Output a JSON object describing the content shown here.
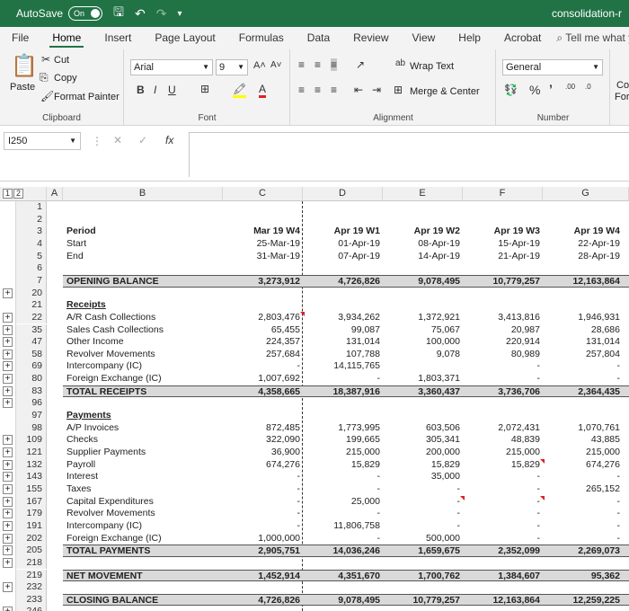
{
  "titlebar": {
    "autosave_label": "AutoSave",
    "autosave_state": "On",
    "doc_title": "consolidation-r"
  },
  "tabs": [
    "File",
    "Home",
    "Insert",
    "Page Layout",
    "Formulas",
    "Data",
    "Review",
    "View",
    "Help",
    "Acrobat"
  ],
  "active_tab": "Home",
  "tell_me": "Tell me what you w",
  "ribbon": {
    "clipboard": {
      "paste": "Paste",
      "cut": "Cut",
      "copy": "Copy",
      "format_painter": "Format Painter",
      "label": "Clipboard"
    },
    "font": {
      "name": "Arial",
      "size": "9",
      "label": "Font"
    },
    "alignment": {
      "wrap_text": "Wrap Text",
      "merge_center": "Merge & Center",
      "label": "Alignment"
    },
    "number": {
      "format": "General",
      "label": "Number"
    },
    "cond_partial": [
      "Co",
      "For"
    ]
  },
  "formula_bar": {
    "namebox": "I250",
    "fx": "fx"
  },
  "columns": [
    "A",
    "B",
    "C",
    "D",
    "E",
    "F",
    "G"
  ],
  "outline_levels": [
    "1",
    "2"
  ],
  "rows": [
    {
      "n": "1"
    },
    {
      "n": "2"
    },
    {
      "n": "3",
      "label": "Period",
      "bold": true,
      "vals": [
        "Mar 19 W4",
        "Apr 19 W1",
        "Apr 19 W2",
        "Apr 19 W3",
        "Apr 19 W4"
      ],
      "valbold": true
    },
    {
      "n": "4",
      "label": "Start",
      "vals": [
        "25-Mar-19",
        "01-Apr-19",
        "08-Apr-19",
        "15-Apr-19",
        "22-Apr-19"
      ]
    },
    {
      "n": "5",
      "label": "End",
      "vals": [
        "31-Mar-19",
        "07-Apr-19",
        "14-Apr-19",
        "21-Apr-19",
        "28-Apr-19"
      ]
    },
    {
      "n": "6"
    },
    {
      "n": "7",
      "label": "OPENING BALANCE",
      "bold": true,
      "shade": true,
      "vals": [
        "3,273,912",
        "4,726,826",
        "9,078,495",
        "10,779,257",
        "12,163,864"
      ],
      "valbold": true
    },
    {
      "n": "20",
      "plus": true
    },
    {
      "n": "21",
      "label": "Receipts",
      "bold": true,
      "underline": true
    },
    {
      "n": "22",
      "plus": true,
      "label": "A/R Cash Collections",
      "vals": [
        "2,803,476",
        "3,934,262",
        "1,372,921",
        "3,413,816",
        "1,946,931"
      ],
      "note": 1
    },
    {
      "n": "35",
      "plus": true,
      "label": "Sales Cash Collections",
      "vals": [
        "65,455",
        "99,087",
        "75,067",
        "20,987",
        "28,686"
      ]
    },
    {
      "n": "47",
      "plus": true,
      "label": "Other Income",
      "vals": [
        "224,357",
        "131,014",
        "100,000",
        "220,914",
        "131,014"
      ]
    },
    {
      "n": "58",
      "plus": true,
      "label": "Revolver Movements",
      "vals": [
        "257,684",
        "107,788",
        "9,078",
        "80,989",
        "257,804"
      ]
    },
    {
      "n": "69",
      "plus": true,
      "label": "Intercompany (IC)",
      "vals": [
        "-",
        "14,115,765",
        "",
        "-",
        "-"
      ]
    },
    {
      "n": "80",
      "plus": true,
      "label": "Foreign Exchange (IC)",
      "vals": [
        "1,007,692",
        "-",
        "1,803,371",
        "-",
        "-"
      ]
    },
    {
      "n": "83",
      "plus": true,
      "label": "TOTAL RECEIPTS",
      "bold": true,
      "shade": true,
      "vals": [
        "4,358,665",
        "18,387,916",
        "3,360,437",
        "3,736,706",
        "2,364,435"
      ],
      "valbold": true
    },
    {
      "n": "96",
      "plus": true
    },
    {
      "n": "97",
      "label": "Payments",
      "bold": true,
      "underline": true
    },
    {
      "n": "98",
      "label": "A/P Invoices",
      "vals": [
        "872,485",
        "1,773,995",
        "603,506",
        "2,072,431",
        "1,070,761"
      ]
    },
    {
      "n": "109",
      "plus": true,
      "label": "Checks",
      "vals": [
        "322,090",
        "199,665",
        "305,341",
        "48,839",
        "43,885"
      ]
    },
    {
      "n": "121",
      "plus": true,
      "label": "Supplier Payments",
      "vals": [
        "36,900",
        "215,000",
        "200,000",
        "215,000",
        "215,000"
      ]
    },
    {
      "n": "132",
      "plus": true,
      "label": "Payroll",
      "vals": [
        "674,276",
        "15,829",
        "15,829",
        "15,829",
        "674,276"
      ],
      "note": 4
    },
    {
      "n": "143",
      "plus": true,
      "label": "Interest",
      "vals": [
        "-",
        "-",
        "35,000",
        "-",
        "-"
      ]
    },
    {
      "n": "155",
      "plus": true,
      "label": "Taxes",
      "vals": [
        "-",
        "-",
        "-",
        "-",
        "265,152"
      ]
    },
    {
      "n": "167",
      "plus": true,
      "label": "Capital Expenditures",
      "vals": [
        "-",
        "25,000",
        "-",
        "-",
        "-"
      ],
      "note": 3,
      "note2": 4
    },
    {
      "n": "179",
      "plus": true,
      "label": "Revolver Movements",
      "vals": [
        "-",
        "-",
        "-",
        "-",
        "-"
      ]
    },
    {
      "n": "191",
      "plus": true,
      "label": "Intercompany (IC)",
      "vals": [
        "-",
        "11,806,758",
        "-",
        "-",
        "-"
      ]
    },
    {
      "n": "202",
      "plus": true,
      "label": "Foreign Exchange (IC)",
      "vals": [
        "1,000,000",
        "-",
        "500,000",
        "-",
        "-"
      ]
    },
    {
      "n": "205",
      "plus": true,
      "label": "TOTAL PAYMENTS",
      "bold": true,
      "shade": true,
      "vals": [
        "2,905,751",
        "14,036,246",
        "1,659,675",
        "2,352,099",
        "2,269,073"
      ],
      "valbold": true
    },
    {
      "n": "218",
      "plus": true
    },
    {
      "n": "219",
      "label": "NET MOVEMENT",
      "bold": true,
      "shade": true,
      "vals": [
        "1,452,914",
        "4,351,670",
        "1,700,762",
        "1,384,607",
        "95,362"
      ],
      "valbold": true
    },
    {
      "n": "232",
      "plus": true
    },
    {
      "n": "233",
      "label": "CLOSING BALANCE",
      "bold": true,
      "shade": true,
      "vals": [
        "4,726,826",
        "9,078,495",
        "10,779,257",
        "12,163,864",
        "12,259,225"
      ],
      "valbold": true
    },
    {
      "n": "246",
      "plus": true
    }
  ]
}
